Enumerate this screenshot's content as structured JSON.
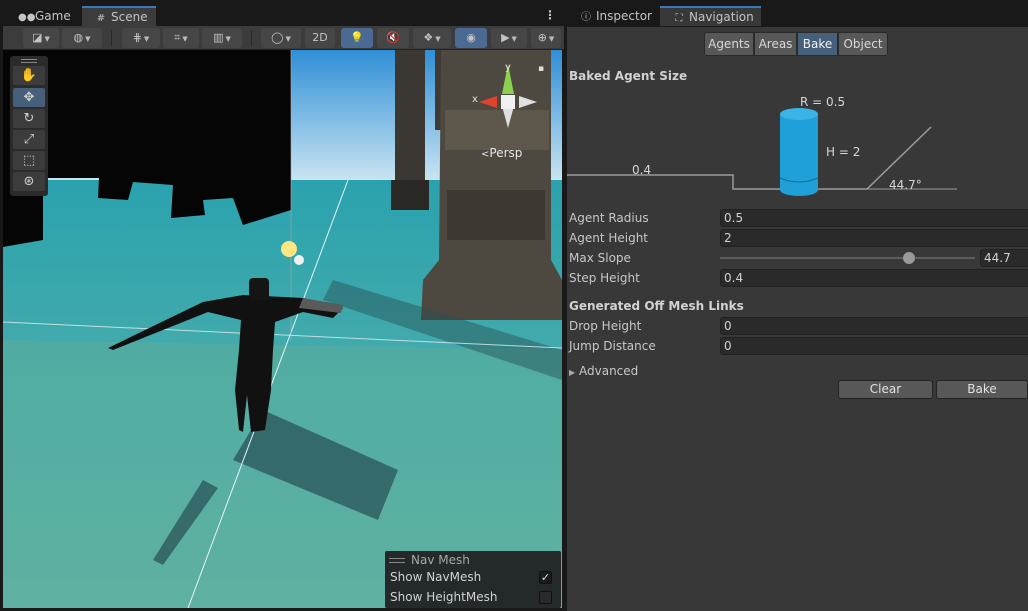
{
  "scene_window": {
    "tabs": [
      {
        "label": "Game",
        "icon": "game-controller-icon"
      },
      {
        "label": "Scene",
        "icon": "grid-icon"
      }
    ],
    "active_tab": "Scene",
    "toolbar": {
      "toggle_2d_label": "2D"
    },
    "gizmo": {
      "axis_y": "y",
      "axis_x": "x",
      "projection_label": "Persp"
    },
    "tools": [
      "hand-tool-icon",
      "move-tool-icon",
      "rotate-tool-icon",
      "scale-tool-icon",
      "rect-tool-icon",
      "transform-tool-icon"
    ],
    "active_tool": "move-tool-icon",
    "nav_overlay": {
      "title": "Nav Mesh",
      "rows": [
        {
          "label": "Show NavMesh",
          "checked": true
        },
        {
          "label": "Show HeightMesh",
          "checked": false
        }
      ]
    }
  },
  "navigation_window": {
    "tabs": [
      {
        "label": "Inspector",
        "icon": "info-icon"
      },
      {
        "label": "Navigation",
        "icon": "navigation-icon"
      }
    ],
    "active_tab": "Navigation",
    "segments": [
      "Agents",
      "Areas",
      "Bake",
      "Object"
    ],
    "active_segment": "Bake",
    "baked_agent_size": {
      "header": "Baked Agent Size",
      "radius_label": "R = 0.5",
      "height_label": "H = 2",
      "step_label": "0.4",
      "slope_label": "44.7°"
    },
    "fields": [
      {
        "label": "Agent Radius",
        "value": "0.5"
      },
      {
        "label": "Agent Height",
        "value": "2"
      },
      {
        "label": "Max Slope",
        "value": "44.7",
        "slider_fraction": 0.74
      },
      {
        "label": "Step Height",
        "value": "0.4"
      }
    ],
    "off_mesh": {
      "header": "Generated Off Mesh Links",
      "fields": [
        {
          "label": "Drop Height",
          "value": "0"
        },
        {
          "label": "Jump Distance",
          "value": "0"
        }
      ]
    },
    "advanced_label": "Advanced",
    "clear_label": "Clear",
    "bake_label": "Bake"
  },
  "colors": {
    "accent": "#3a79bb",
    "selected": "#46607c",
    "navmesh": "#39a8b3",
    "cylinder": "#1fa0d8"
  }
}
